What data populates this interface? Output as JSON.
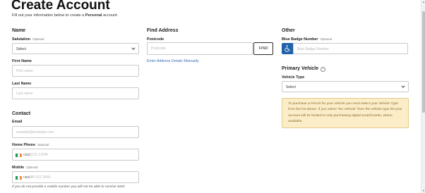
{
  "header": {
    "title": "Create Account",
    "subtitle_pre": "Fill out your information below to create a ",
    "subtitle_bold": "Personal",
    "subtitle_post": " account."
  },
  "name_section": {
    "heading": "Name",
    "salutation_label": "Salutation",
    "salutation_optional": "Optional",
    "salutation_value": "Select",
    "first_name_label": "First Name",
    "first_name_placeholder": "First name",
    "last_name_label": "Last Name",
    "last_name_placeholder": "Last name"
  },
  "contact_section": {
    "heading": "Contact",
    "email_label": "Email",
    "email_placeholder": "example@example.com",
    "home_phone_label": "Home Phone",
    "home_phone_optional": "Optional",
    "home_phone_code": "+353",
    "home_phone_placeholder": "(022) 12345",
    "mobile_label": "Mobile",
    "mobile_optional": "Optional",
    "mobile_code": "+353",
    "mobile_placeholder": "085 012 3456",
    "footnote": "If you do not provide a mobile number you will not be able to receive SMS"
  },
  "address_section": {
    "heading": "Find Address",
    "postcode_label": "Postcode",
    "postcode_placeholder": "Postcode",
    "find_button": "FIND",
    "manual_link": "Enter Address Details Manually"
  },
  "other_section": {
    "heading": "Other",
    "blue_badge_label": "Blue Badge Number",
    "blue_badge_optional": "Optional",
    "blue_badge_placeholder": "Blue Badge Number",
    "blue_badge_icon": "wheelchair-icon"
  },
  "vehicle_section": {
    "heading": "Primary Vehicle",
    "info_icon": "info-icon",
    "vehicle_type_label": "Vehicle Type",
    "vehicle_type_value": "Select",
    "notice": "To purchase a Permit for your vehicle you must select your Vehicle Type from the list above. If you select \"No Vehicle\" from the vehicle type list your account will be limited to only purchasing digital scratchcards, where available."
  },
  "colors": {
    "accent_blue": "#2160ab",
    "link_blue": "#3b6fb6",
    "notice_bg": "#fcedc9",
    "notice_border": "#e5c98a",
    "notice_text": "#8a6a2a",
    "flag_green": "#169b62",
    "flag_white": "#ffffff",
    "flag_orange": "#ff883e"
  }
}
